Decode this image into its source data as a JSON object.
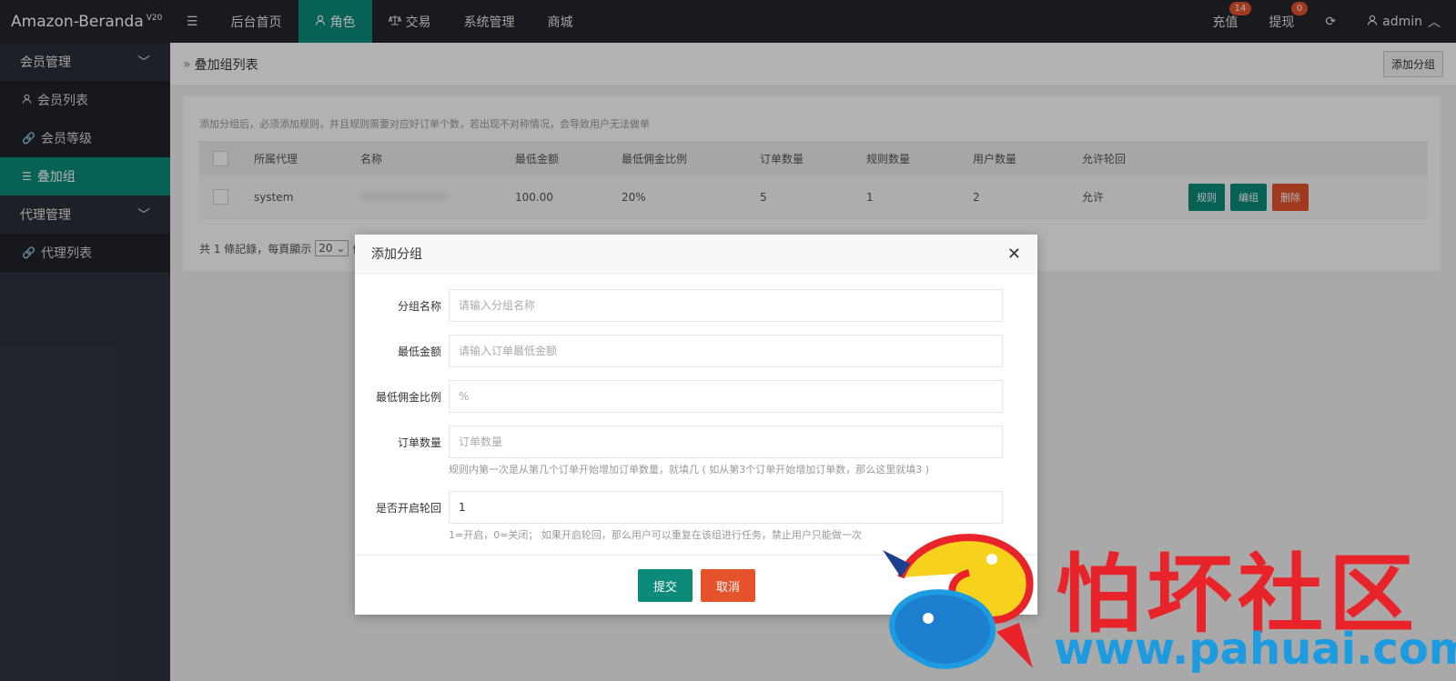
{
  "app": {
    "name": "Amazon-Beranda",
    "version": "V20"
  },
  "topnav": [
    {
      "label": "后台首页",
      "icon": "",
      "active": false
    },
    {
      "label": "角色",
      "icon": "user-icon",
      "active": true
    },
    {
      "label": "交易",
      "icon": "scale-icon",
      "active": false
    },
    {
      "label": "系统管理",
      "icon": "",
      "active": false
    },
    {
      "label": "商城",
      "icon": "",
      "active": false
    }
  ],
  "topright": {
    "recharge": {
      "label": "充值",
      "badge": "14"
    },
    "withdraw": {
      "label": "提现",
      "badge": "0"
    },
    "user": "admin"
  },
  "sidebar": {
    "member_group": "会员管理",
    "member_items": [
      "会员列表",
      "会员等级",
      "叠加组"
    ],
    "agent_group": "代理管理",
    "agent_items": [
      "代理列表"
    ]
  },
  "page": {
    "breadcrumb": "叠加组列表",
    "add_button": "添加分组",
    "notice": "添加分组后，必须添加规则，并且规则需要对应好订单个数，若出现不对称情况，会导致用户无法做单"
  },
  "table": {
    "headers": [
      "所属代理",
      "名称",
      "最低金额",
      "最低佣金比例",
      "订单数量",
      "规则数量",
      "用户数量",
      "允许轮回"
    ],
    "rows": [
      {
        "agent": "system",
        "name": "",
        "min_amount": "100.00",
        "min_ratio": "20%",
        "orders": "5",
        "rules": "1",
        "users": "2",
        "loop": "允许"
      }
    ],
    "actions": {
      "rule": "规则",
      "edit": "编组",
      "delete": "删除"
    }
  },
  "pager": {
    "prefix": "共 1 條記錄，每頁顯示",
    "page_size": "20",
    "suffix": "條"
  },
  "modal": {
    "title": "添加分组",
    "fields": [
      {
        "label": "分组名称",
        "value": "",
        "placeholder": "请输入分组名称",
        "hint": ""
      },
      {
        "label": "最低金额",
        "value": "",
        "placeholder": "请输入订单最低金额",
        "hint": ""
      },
      {
        "label": "最低佣金比例",
        "value": "",
        "placeholder": "%",
        "hint": ""
      },
      {
        "label": "订单数量",
        "value": "",
        "placeholder": "订单数量",
        "hint": "规则内第一次是从第几个订单开始增加订单数量，就填几 ( 如从第3个订单开始增加订单数，那么这里就填3 )"
      },
      {
        "label": "是否开启轮回",
        "value": "1",
        "placeholder": "",
        "hint": "1=开启，0=关闭； 如果开启轮回，那么用户可以重复在该组进行任务，禁止用户只能做一次"
      }
    ],
    "submit": "提交",
    "cancel": "取消"
  },
  "watermark": {
    "title": "怕坏社区",
    "url": "www.pahuai.com"
  },
  "colors": {
    "accent": "#0c8b7a",
    "danger": "#e5532d",
    "topbar": "#23262e",
    "sidebar": "#2f3340"
  }
}
